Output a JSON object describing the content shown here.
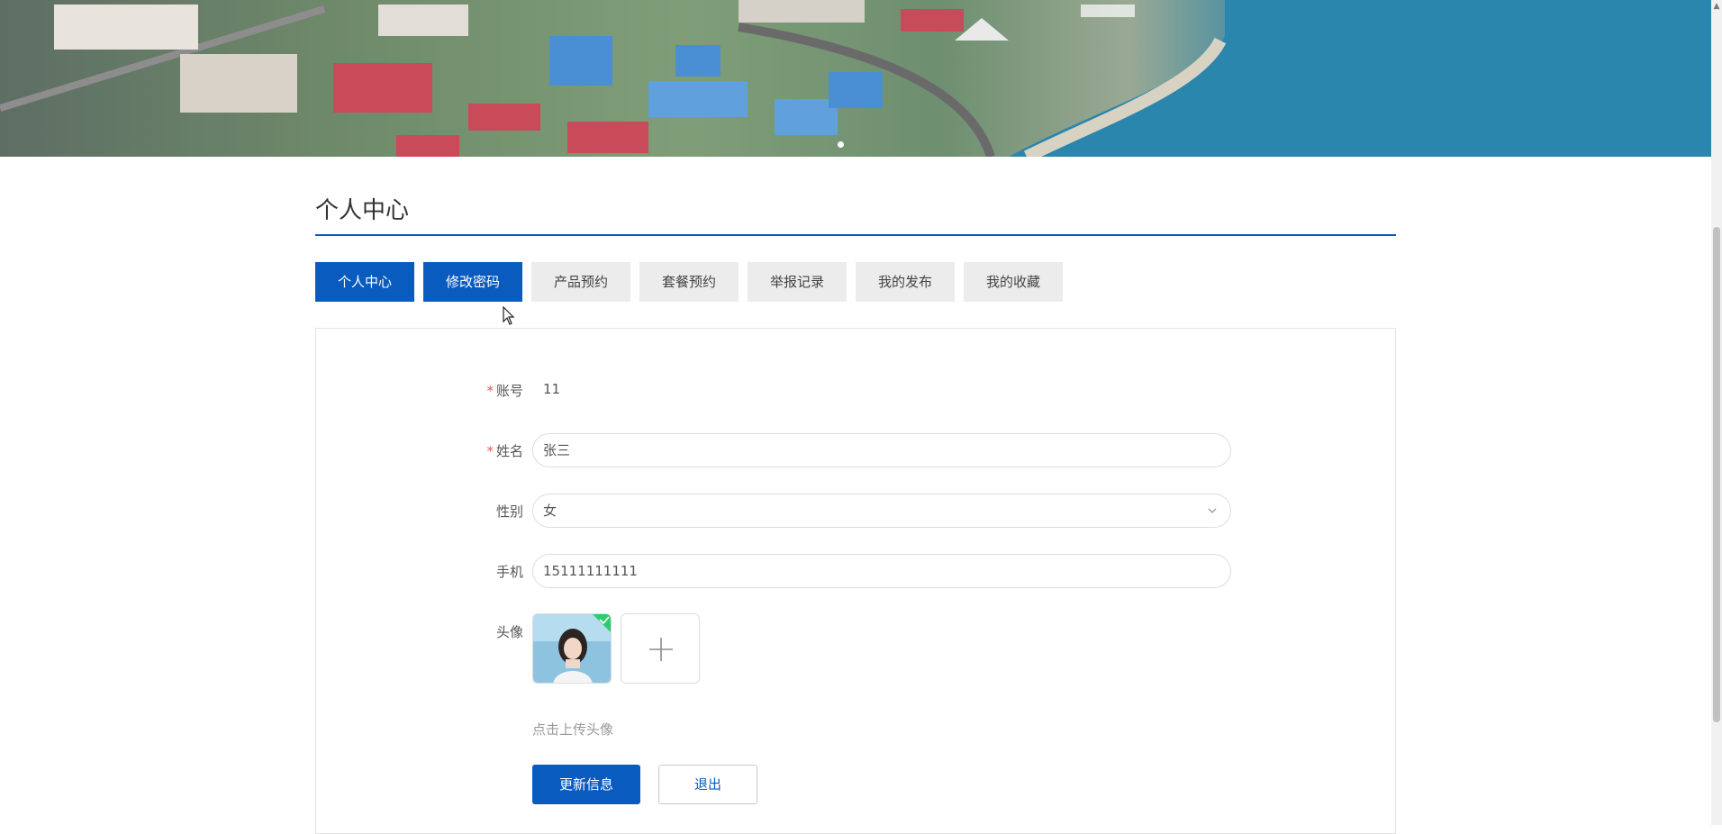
{
  "page": {
    "title": "个人中心"
  },
  "tabs": [
    {
      "label": "个人中心",
      "active": true
    },
    {
      "label": "修改密码",
      "active": true
    },
    {
      "label": "产品预约",
      "active": false
    },
    {
      "label": "套餐预约",
      "active": false
    },
    {
      "label": "举报记录",
      "active": false
    },
    {
      "label": "我的发布",
      "active": false
    },
    {
      "label": "我的收藏",
      "active": false
    }
  ],
  "form": {
    "account": {
      "required_mark": "*",
      "label": "账号",
      "value": "11"
    },
    "name": {
      "required_mark": "*",
      "label": "姓名",
      "value": "张三"
    },
    "gender": {
      "label": "性别",
      "value": "女"
    },
    "phone": {
      "label": "手机",
      "value": "15111111111"
    },
    "avatar": {
      "label": "头像",
      "hint": "点击上传头像"
    }
  },
  "buttons": {
    "update": "更新信息",
    "logout": "退出"
  },
  "colors": {
    "primary": "#0a5bbf",
    "tab_bg": "#ececec",
    "required": "#e65a5a",
    "uploaded": "#2ecc71"
  }
}
